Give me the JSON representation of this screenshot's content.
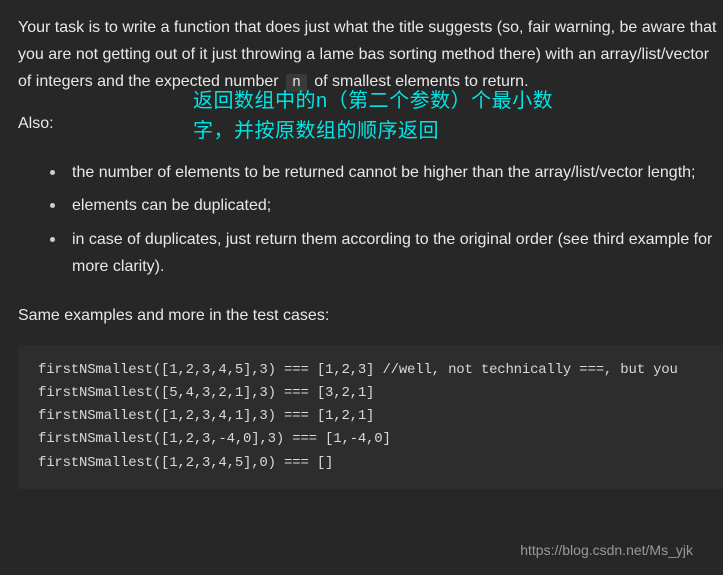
{
  "task": {
    "sentence_pre": "Your task is to write a function that does just what the title suggests (so, fair warning, be aware that you are not getting out of it just throwing a lame bas sorting method there) with an array/list/vector of integers and the expected number ",
    "code_token": "n",
    "sentence_post": " of smallest elements to return."
  },
  "annotation": {
    "line1": "返回数组中的n（第二个参数）个最小数",
    "line2": "字，并按原数组的顺序返回"
  },
  "also_label": "Also:",
  "requirements": [
    "the number of elements to be returned cannot be higher than the array/list/vector length;",
    "elements can be duplicated;",
    "in case of duplicates, just return them according to the original order (see third example for more clarity)."
  ],
  "examples_intro": "Same examples and more in the test cases:",
  "code_lines": [
    "firstNSmallest([1,2,3,4,5],3) === [1,2,3] //well, not technically ===, but you",
    "firstNSmallest([5,4,3,2,1],3) === [3,2,1]",
    "firstNSmallest([1,2,3,4,1],3) === [1,2,1]",
    "firstNSmallest([1,2,3,-4,0],3) === [1,-4,0]",
    "firstNSmallest([1,2,3,4,5],0) === []"
  ],
  "watermark": "https://blog.csdn.net/Ms_yjk"
}
